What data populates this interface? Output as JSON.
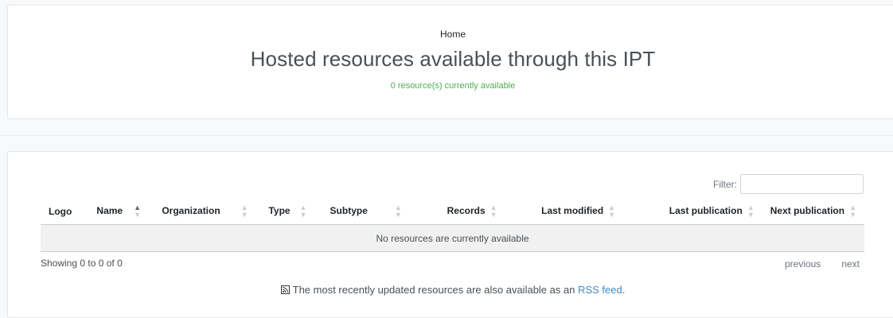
{
  "header": {
    "breadcrumb": "Home",
    "title": "Hosted resources available through this IPT",
    "resource_count": "0 resource(s) currently available"
  },
  "filter": {
    "label": "Filter:",
    "value": ""
  },
  "table": {
    "columns": [
      {
        "label": "Logo",
        "sortable": false
      },
      {
        "label": "Name",
        "sortable": true,
        "sort": "asc"
      },
      {
        "label": "Organization",
        "sortable": true
      },
      {
        "label": "Type",
        "sortable": true
      },
      {
        "label": "Subtype",
        "sortable": true
      },
      {
        "label": "Records",
        "sortable": true
      },
      {
        "label": "Last modified",
        "sortable": true
      },
      {
        "label": "Last publication",
        "sortable": true
      },
      {
        "label": "Next publication",
        "sortable": true
      }
    ],
    "empty_message": "No resources are currently available"
  },
  "pagination": {
    "info": "Showing 0 to 0 of 0",
    "previous": "previous",
    "next": "next"
  },
  "rss": {
    "text_before": "The most recently updated resources are also available as an",
    "link_text": "RSS feed",
    "text_after": "."
  },
  "colors": {
    "accent_green": "#4caf50",
    "link_blue": "#3a8dc8"
  },
  "icons": {
    "sort": "sort-icon",
    "sort_asc": "sort-asc-icon",
    "rss": "rss-icon"
  }
}
